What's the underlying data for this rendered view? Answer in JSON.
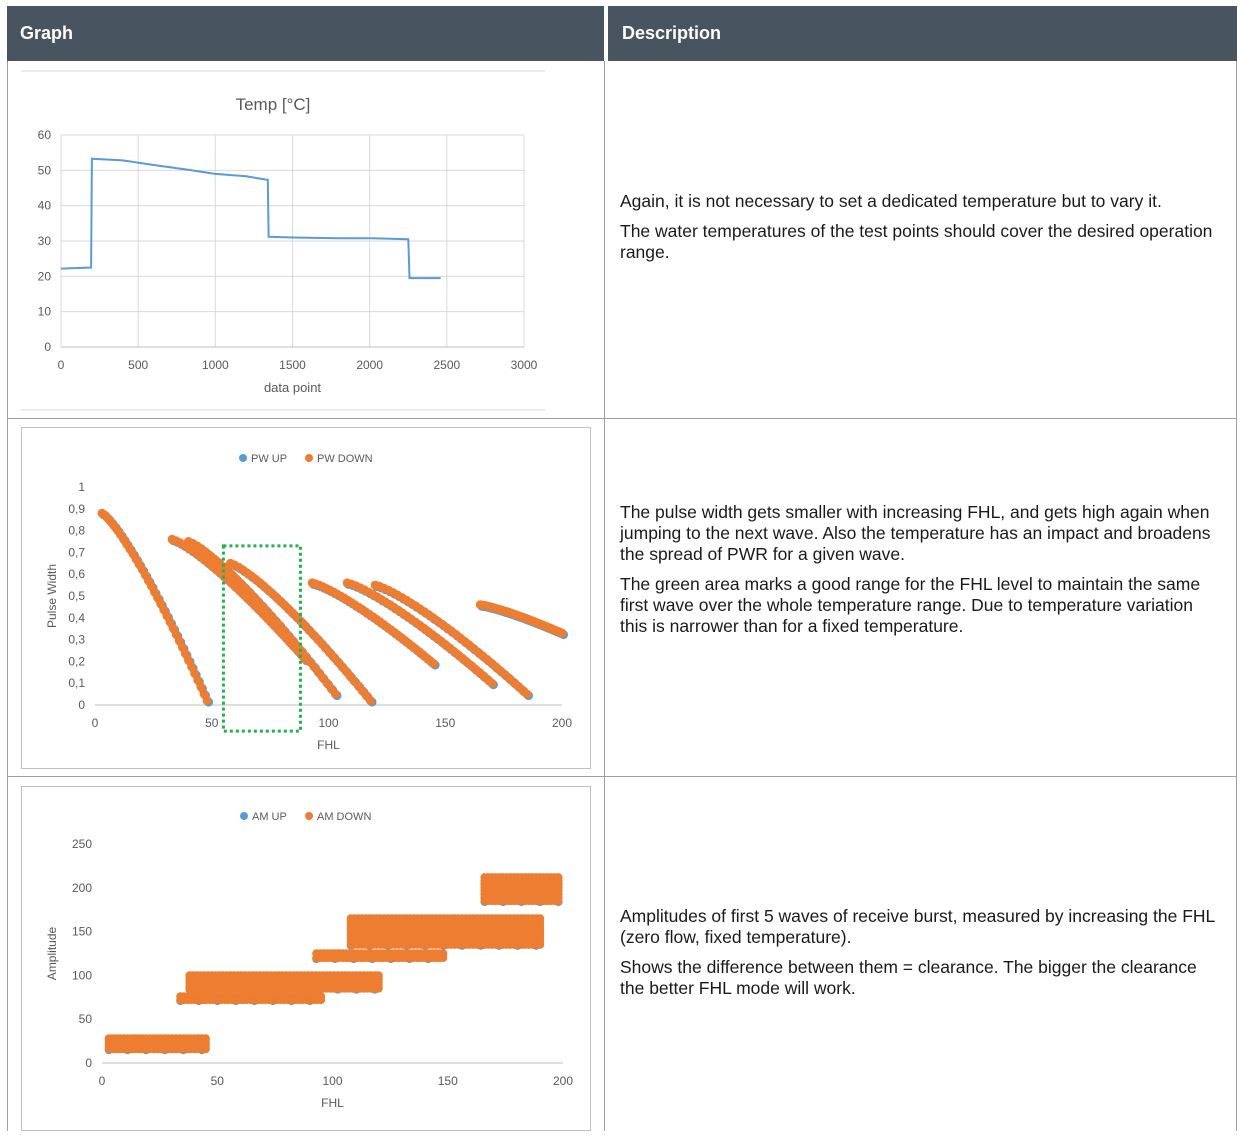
{
  "header": {
    "graph": "Graph",
    "description": "Description"
  },
  "rows": [
    {
      "description": [
        "Again, it is not necessary to set a dedicated temperature but to vary it.",
        "The water temperatures of the test points should cover the desired operation range."
      ]
    },
    {
      "description": [
        "The pulse width gets smaller with increasing FHL, and gets high again when jumping to the next wave. Also the temperature has an impact and broadens the spread of PWR for a given wave.",
        "The green area marks a good range for the FHL level to maintain the same first wave over the whole temperature range. Due to temperature variation this is narrower than for a fixed temperature."
      ]
    },
    {
      "description": [
        "Amplitudes of first 5 waves of receive burst, measured by increasing the FHL (zero flow, fixed temperature).",
        "Shows the difference between them = clearance. The bigger the clearance the better FHL mode will work."
      ]
    }
  ],
  "chart_data": [
    {
      "type": "line",
      "title": "Temp [°C]",
      "xlabel": "data point",
      "ylabel": "",
      "xlim": [
        0,
        3000
      ],
      "ylim": [
        0,
        60
      ],
      "xticks": [
        "0",
        "500",
        "1000",
        "1500",
        "2000",
        "2500",
        "3000"
      ],
      "yticks": [
        "0",
        "10",
        "20",
        "30",
        "40",
        "50",
        "60"
      ],
      "grid": true,
      "color": "#5b9bd5",
      "series": [
        {
          "x": [
            0,
            195,
            200,
            400,
            600,
            800,
            1000,
            1200,
            1340,
            1345,
            1500,
            1800,
            2000,
            2250,
            2258,
            2300,
            2460
          ],
          "y": [
            22.2,
            22.5,
            53.3,
            52.8,
            51.5,
            50.3,
            49.0,
            48.3,
            47.3,
            31.2,
            31.0,
            30.8,
            30.8,
            30.5,
            19.5,
            19.5,
            19.5
          ]
        }
      ]
    },
    {
      "type": "scatter",
      "title": "",
      "xlabel": "FHL",
      "ylabel": "Pulse Width",
      "xlim": [
        0,
        200
      ],
      "ylim": [
        0,
        1
      ],
      "xticks": [
        "0",
        "50",
        "100",
        "150",
        "200"
      ],
      "yticks": [
        "0",
        "0,1",
        "0,2",
        "0,3",
        "0,4",
        "0,5",
        "0,6",
        "0,7",
        "0,8",
        "0,9",
        "1"
      ],
      "legend": "top",
      "highlight": {
        "x0": 55,
        "x1": 88,
        "y0": 0.73,
        "y1": -0.12,
        "color": "#22b14c"
      },
      "series": [
        {
          "name": "PW UP",
          "color": "#5b9bd5",
          "segments": [
            {
              "x0": 3,
              "x1": 48,
              "y0": 0.88,
              "y1": 0.02
            },
            {
              "x0": 33,
              "x1": 90,
              "y0": 0.76,
              "y1": 0.21
            },
            {
              "x0": 40,
              "x1": 103,
              "y0": 0.75,
              "y1": 0.05
            },
            {
              "x0": 58,
              "x1": 118,
              "y0": 0.65,
              "y1": 0.02
            },
            {
              "x0": 93,
              "x1": 145,
              "y0": 0.56,
              "y1": 0.19
            },
            {
              "x0": 108,
              "x1": 170,
              "y0": 0.56,
              "y1": 0.1
            },
            {
              "x0": 120,
              "x1": 185,
              "y0": 0.55,
              "y1": 0.05
            },
            {
              "x0": 165,
              "x1": 200,
              "y0": 0.46,
              "y1": 0.33
            }
          ]
        },
        {
          "name": "PW DOWN",
          "color": "#ed7d31",
          "segments": [
            {
              "x0": 3,
              "x1": 48,
              "y0": 0.88,
              "y1": 0.02
            },
            {
              "x0": 33,
              "x1": 90,
              "y0": 0.76,
              "y1": 0.21
            },
            {
              "x0": 40,
              "x1": 103,
              "y0": 0.75,
              "y1": 0.05
            },
            {
              "x0": 58,
              "x1": 118,
              "y0": 0.65,
              "y1": 0.02
            },
            {
              "x0": 93,
              "x1": 145,
              "y0": 0.56,
              "y1": 0.19
            },
            {
              "x0": 108,
              "x1": 170,
              "y0": 0.56,
              "y1": 0.1
            },
            {
              "x0": 120,
              "x1": 185,
              "y0": 0.55,
              "y1": 0.05
            },
            {
              "x0": 165,
              "x1": 200,
              "y0": 0.46,
              "y1": 0.33
            }
          ]
        }
      ]
    },
    {
      "type": "scatter",
      "title": "",
      "xlabel": "FHL",
      "ylabel": "Amplitude",
      "xlim": [
        0,
        200
      ],
      "ylim": [
        0,
        250
      ],
      "xticks": [
        "0",
        "50",
        "100",
        "150",
        "200"
      ],
      "yticks": [
        "0",
        "50",
        "100",
        "150",
        "200",
        "250"
      ],
      "legend": "top",
      "series": [
        {
          "name": "AM UP",
          "color": "#5b9bd5",
          "bands": [
            {
              "x0": 3,
              "x1": 45,
              "y0": 16,
              "y1": 28
            },
            {
              "x0": 34,
              "x1": 95,
              "y0": 72,
              "y1": 76
            },
            {
              "x0": 38,
              "x1": 120,
              "y0": 85,
              "y1": 100
            },
            {
              "x0": 93,
              "x1": 148,
              "y0": 120,
              "y1": 125
            },
            {
              "x0": 108,
              "x1": 190,
              "y0": 135,
              "y1": 165
            },
            {
              "x0": 166,
              "x1": 198,
              "y0": 185,
              "y1": 212
            }
          ]
        },
        {
          "name": "AM DOWN",
          "color": "#ed7d31",
          "bands": [
            {
              "x0": 3,
              "x1": 45,
              "y0": 16,
              "y1": 28
            },
            {
              "x0": 34,
              "x1": 95,
              "y0": 72,
              "y1": 76
            },
            {
              "x0": 38,
              "x1": 120,
              "y0": 85,
              "y1": 100
            },
            {
              "x0": 93,
              "x1": 148,
              "y0": 120,
              "y1": 125
            },
            {
              "x0": 108,
              "x1": 190,
              "y0": 135,
              "y1": 165
            },
            {
              "x0": 166,
              "x1": 198,
              "y0": 185,
              "y1": 212
            }
          ]
        }
      ]
    }
  ]
}
